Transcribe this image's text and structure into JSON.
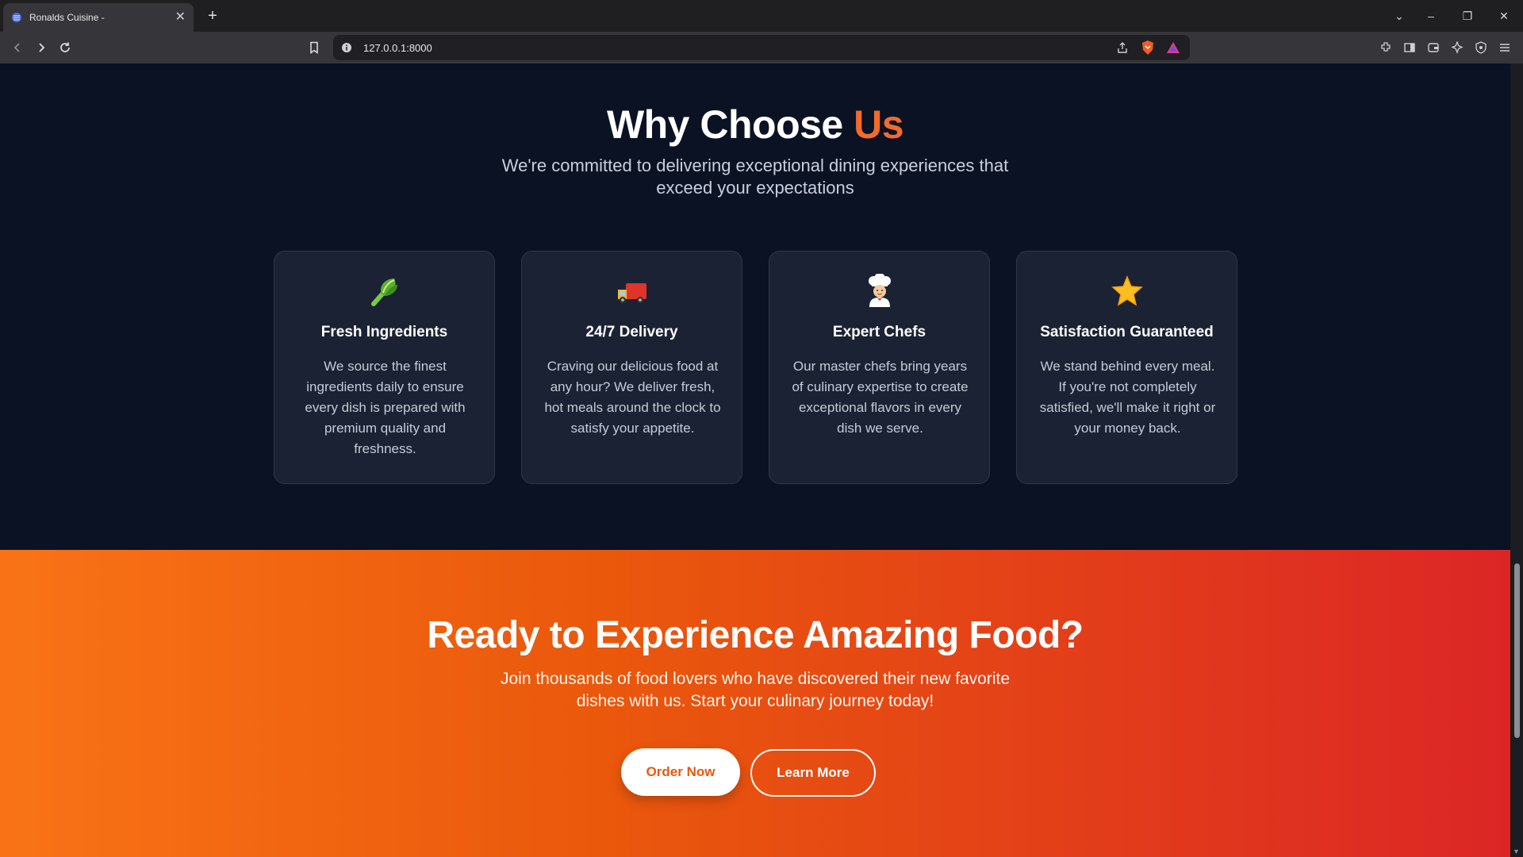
{
  "browser": {
    "tab_title": "Ronalds Cuisine -",
    "tab_close": "✕",
    "new_tab": "+",
    "url": "127.0.0.1:8000",
    "win_controls": {
      "dropdown": "⌄",
      "minimize": "–",
      "restore": "❐",
      "close": "✕"
    }
  },
  "why": {
    "title_main": "Why Choose ",
    "title_accent": "Us",
    "subtitle": "We're committed to delivering exceptional dining experiences that exceed your expectations",
    "cards": [
      {
        "icon": "lettuce-icon",
        "title": "Fresh Ingredients",
        "text": "We source the finest ingredients daily to ensure every dish is prepared with premium quality and freshness."
      },
      {
        "icon": "delivery-truck-icon",
        "title": "24/7 Delivery",
        "text": "Craving our delicious food at any hour? We deliver fresh, hot meals around the clock to satisfy your appetite."
      },
      {
        "icon": "chef-icon",
        "title": "Expert Chefs",
        "text": "Our master chefs bring years of culinary expertise to create exceptional flavors in every dish we serve."
      },
      {
        "icon": "star-icon",
        "title": "Satisfaction Guaranteed",
        "text": "We stand behind every meal. If you're not completely satisfied, we'll make it right or your money back."
      }
    ]
  },
  "cta": {
    "title": "Ready to Experience Amazing Food?",
    "subtitle": "Join thousands of food lovers who have discovered their new favorite dishes with us. Start your culinary journey today!",
    "primary_label": "Order Now",
    "secondary_label": "Learn More"
  },
  "colors": {
    "accent": "#f26b2c",
    "section_bg": "#0b1224",
    "card_bg": "#1b2233",
    "cta_gradient_start": "#f97316",
    "cta_gradient_end": "#dc2626"
  }
}
